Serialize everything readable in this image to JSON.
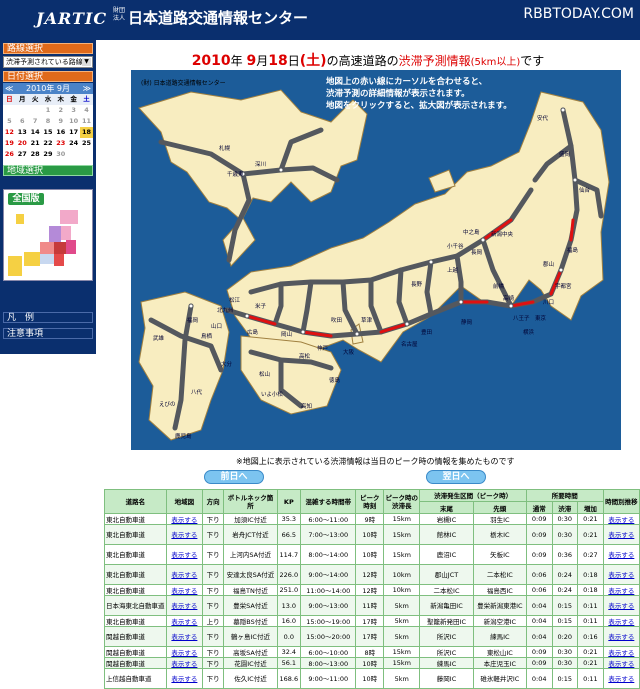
{
  "header": {
    "logo": "JARTIC",
    "corp": "財団法人",
    "title": "日本道路交通情報センター",
    "watermark": "RBBTODAY.COM"
  },
  "sidebar": {
    "route_head": "路線選択",
    "route_select": "渋滞予測されている路線",
    "date_head": "日付選択",
    "cal_prev": "≪",
    "cal_title": "2010年 9月",
    "cal_next": "≫",
    "weekdays": [
      "日",
      "月",
      "火",
      "水",
      "木",
      "金",
      "土"
    ],
    "days": [
      [
        "",
        "",
        "",
        "1",
        "2",
        "3",
        "4"
      ],
      [
        "5",
        "6",
        "7",
        "8",
        "9",
        "10",
        "11"
      ],
      [
        "12",
        "13",
        "14",
        "15",
        "16",
        "17",
        "18"
      ],
      [
        "19",
        "20",
        "21",
        "22",
        "23",
        "24",
        "25"
      ],
      [
        "26",
        "27",
        "28",
        "29",
        "30",
        "",
        ""
      ]
    ],
    "region_head": "地域選択",
    "region_all": "全国版",
    "legend_head": "凡　例",
    "notes_head": "注意事項"
  },
  "main": {
    "t_year": "2010",
    "t_yearsuffix": "年",
    "t_month": "9",
    "t_monthsuffix": "月",
    "t_day": "18",
    "t_daysuffix": "日",
    "t_dow": "(土)",
    "t_mid": "の高速道路の",
    "t_red": "渋滞予測情報",
    "t_red2": "(5km以上)",
    "t_end": "です",
    "map_logo": "(財) 日本道路交通情報センター",
    "hint1": "地図上の赤い線にカーソルを合わせると、",
    "hint2": "渋滞予測の詳細情報が表示されます。",
    "hint3": "地図をクリックすると、拡大図が表示されます。",
    "note": "※地図上に表示されている渋滞情報は当日のピーク時の情報を集めたものです",
    "prev": "前日へ",
    "next": "翌日へ"
  },
  "map_labels": [
    "札幌",
    "千歳東",
    "深川",
    "安代",
    "盛岡",
    "仙台",
    "新潟中央",
    "長岡",
    "上越",
    "郡山",
    "福島",
    "宇都宮",
    "高崎",
    "前橋",
    "八王子",
    "川口",
    "中之島",
    "東京",
    "横浜",
    "静岡",
    "名古屋",
    "大阪",
    "神戸",
    "広島",
    "岡山",
    "福岡",
    "武雄",
    "鳥栖",
    "八代",
    "えびの",
    "鹿児島",
    "松山",
    "高知",
    "いよ小松",
    "高松",
    "徳島",
    "小千谷",
    "長野",
    "豊田",
    "草津",
    "吹田",
    "米子",
    "松江",
    "山口",
    "北九州",
    "大分"
  ],
  "table": {
    "h1": [
      "道路名",
      "地域図",
      "方向",
      "ボトルネック箇所",
      "KP",
      "混雑する時間帯",
      "ピーク時刻",
      "ピーク時の渋滞長",
      "渋滞発生区間（ピーク時）",
      "所要時間",
      "時間別推移"
    ],
    "h2": [
      "末尾",
      "先頭",
      "通常",
      "渋滞",
      "増加"
    ],
    "rows": [
      [
        "東北自動車道",
        "表示する",
        "下り",
        "加須IC付近",
        "35.3",
        "6:00〜11:00",
        "9時",
        "15km",
        "岩槻IC",
        "羽生IC",
        "0:09",
        "0:30",
        "0:21",
        "表示する"
      ],
      [
        "東北自動車道",
        "表示する",
        "下り",
        "岩舟JCT付近",
        "66.5",
        "7:00〜13:00",
        "10時",
        "15km",
        "館林IC",
        "栃木IC",
        "0:09",
        "0:30",
        "0:21",
        "表示する"
      ],
      [
        "東北自動車道",
        "表示する",
        "下り",
        "上河内SA付近",
        "114.7",
        "8:00〜14:00",
        "10時",
        "15km",
        "鹿沼IC",
        "矢板IC",
        "0:09",
        "0:36",
        "0:27",
        "表示する"
      ],
      [
        "東北自動車道",
        "表示する",
        "下り",
        "安達太良SA付近",
        "226.0",
        "9:00〜14:00",
        "12時",
        "10km",
        "郡山JCT",
        "二本松IC",
        "0:06",
        "0:24",
        "0:18",
        "表示する"
      ],
      [
        "東北自動車道",
        "表示する",
        "下り",
        "福島TN付近",
        "251.0",
        "11:00〜14:00",
        "12時",
        "10km",
        "二本松IC",
        "福島西IC",
        "0:06",
        "0:24",
        "0:18",
        "表示する"
      ],
      [
        "日本海東北自動車道",
        "表示する",
        "下り",
        "豊栄SA付近",
        "13.0",
        "9:00〜13:00",
        "11時",
        "5km",
        "新潟亀田IC",
        "豊栄新潟東港IC",
        "0:04",
        "0:15",
        "0:11",
        "表示する"
      ],
      [
        "東北自動車道",
        "表示する",
        "上り",
        "墓隠BS付近",
        "16.0",
        "15:00〜19:00",
        "17時",
        "5km",
        "聖籠新発田IC",
        "新潟空港IC",
        "0:04",
        "0:15",
        "0:11",
        "表示する"
      ],
      [
        "関越自動車道",
        "表示する",
        "下り",
        "鶴ヶ島IC付近",
        "0.0",
        "15:00〜20:00",
        "17時",
        "5km",
        "所沢IC",
        "練馬IC",
        "0:04",
        "0:20",
        "0:16",
        "表示する"
      ],
      [
        "関越自動車道",
        "表示する",
        "下り",
        "高坂SA付近",
        "32.4",
        "6:00〜10:00",
        "8時",
        "15km",
        "所沢IC",
        "東松山IC",
        "0:09",
        "0:30",
        "0:21",
        "表示する"
      ],
      [
        "関越自動車道",
        "表示する",
        "下り",
        "花園IC付近",
        "56.1",
        "8:00〜13:00",
        "10時",
        "15km",
        "練馬IC",
        "本庄児玉IC",
        "0:09",
        "0:30",
        "0:21",
        "表示する"
      ],
      [
        "上信越自動車道",
        "表示する",
        "下り",
        "佐久IC付近",
        "168.6",
        "9:00〜11:00",
        "10時",
        "5km",
        "藤岡IC",
        "碓氷軽井沢IC",
        "0:04",
        "0:15",
        "0:11",
        "表示する"
      ]
    ]
  },
  "colors": {
    "header": "#0a2f6e",
    "sidebar_head": "#e06a1a",
    "sea": "#1c5c99",
    "land": "#f8edc0",
    "road": "#54585e",
    "jam": "#e01010",
    "table_head": "#c6eac6"
  }
}
